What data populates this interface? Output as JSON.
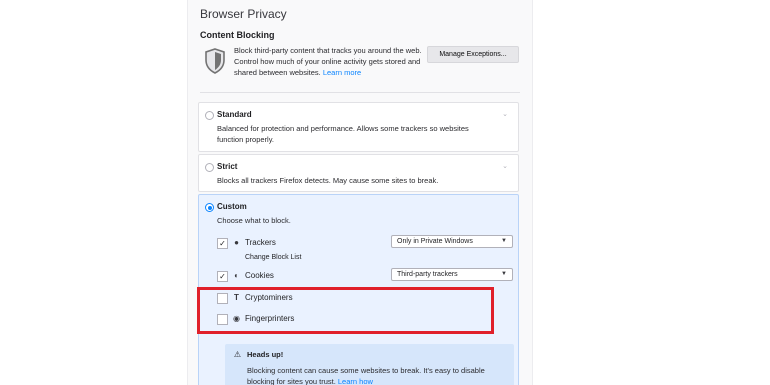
{
  "window": {
    "section_title": "Browser Privacy"
  },
  "content_blocking": {
    "title": "Content Blocking",
    "description": "Block third-party content that tracks you around the web. Control how much of your online activity gets stored and shared between websites.",
    "learn_more": "Learn more",
    "manage_button": "Manage Exceptions..."
  },
  "options": {
    "standard": {
      "title": "Standard",
      "description": "Balanced for protection and performance. Allows some trackers so websites function properly."
    },
    "strict": {
      "title": "Strict",
      "description": "Blocks all trackers Firefox detects. May cause some sites to break."
    },
    "custom": {
      "title": "Custom",
      "description": "Choose what to block.",
      "items": [
        {
          "label": "Trackers",
          "checked": true,
          "select": "Only in Private Windows",
          "link": "Change Block List"
        },
        {
          "label": "Cookies",
          "checked": true,
          "select": "Third-party trackers"
        },
        {
          "label": "Cryptominers",
          "checked": false
        },
        {
          "label": "Fingerprinters",
          "checked": false
        }
      ],
      "notice": {
        "title": "Heads up!",
        "text": "Blocking content can cause some websites to break. It's easy to disable blocking for sites you trust.",
        "learn_more": "Learn how"
      }
    }
  },
  "colors": {
    "accent": "#0a84ff",
    "highlight": "#e0202a"
  }
}
